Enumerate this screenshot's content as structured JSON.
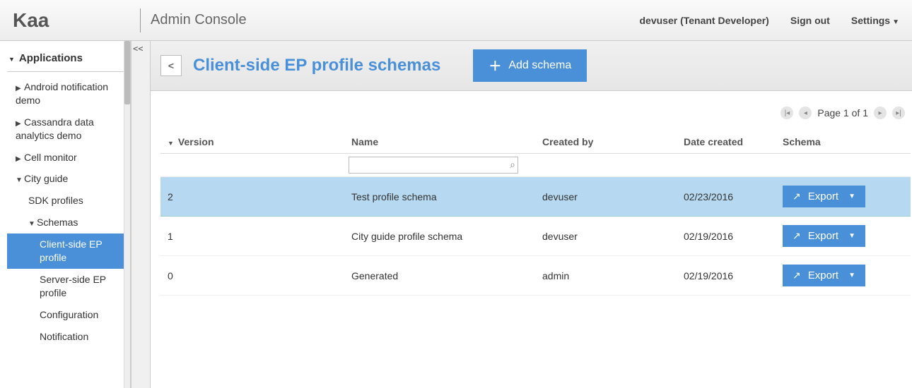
{
  "header": {
    "brand": "Kaa",
    "subtitle": "Admin Console",
    "user": "devuser (Tenant Developer)",
    "signout": "Sign out",
    "settings": "Settings"
  },
  "sidebar": {
    "section": "Applications",
    "items": [
      {
        "label": "Android notification demo",
        "expanded": false,
        "level": 1
      },
      {
        "label": "Cassandra data analytics demo",
        "expanded": false,
        "level": 1
      },
      {
        "label": "Cell monitor",
        "expanded": false,
        "level": 1
      },
      {
        "label": "City guide",
        "expanded": true,
        "level": 1
      },
      {
        "label": "SDK profiles",
        "level": 2
      },
      {
        "label": "Schemas",
        "expanded": true,
        "level": 2
      },
      {
        "label": "Client-side EP profile",
        "level": 3,
        "selected": true
      },
      {
        "label": "Server-side EP profile",
        "level": 3
      },
      {
        "label": "Configuration",
        "level": 3
      },
      {
        "label": "Notification",
        "level": 3
      }
    ],
    "collapse": "<<"
  },
  "page": {
    "title": "Client-side EP profile schemas",
    "back": "<",
    "add_label": "Add schema"
  },
  "pager": {
    "text": "Page 1 of 1"
  },
  "table": {
    "columns": {
      "version": "Version",
      "name": "Name",
      "created_by": "Created by",
      "date_created": "Date created",
      "schema": "Schema"
    },
    "filter_placeholder": "",
    "export_label": "Export",
    "rows": [
      {
        "version": "2",
        "name": "Test profile schema",
        "created_by": "devuser",
        "date_created": "02/23/2016",
        "selected": true
      },
      {
        "version": "1",
        "name": "City guide profile schema",
        "created_by": "devuser",
        "date_created": "02/19/2016"
      },
      {
        "version": "0",
        "name": "Generated",
        "created_by": "admin",
        "date_created": "02/19/2016"
      }
    ]
  }
}
